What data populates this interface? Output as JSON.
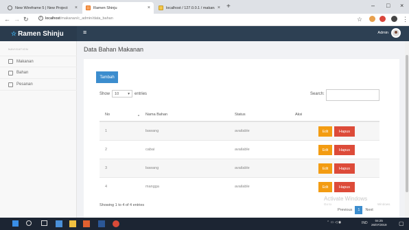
{
  "browser": {
    "tabs": [
      {
        "title": "New Wireframe 5 | New Project",
        "close": "×"
      },
      {
        "title": "Ramen Shinju",
        "close": "×"
      },
      {
        "title": "localhost / 127.0.0.1 / makanan",
        "close": "×"
      }
    ],
    "new_tab": "+",
    "window_controls": [
      "–",
      "□",
      "×"
    ],
    "url_host": "localhost",
    "url_path": "/makanan/c_admin/data_bahan"
  },
  "app": {
    "brand_icon": "☆",
    "brand": "Ramen Shinju",
    "menu_icon": "≡",
    "user": "Admin"
  },
  "sidebar": {
    "heading": "NAVIGATION",
    "items": [
      {
        "label": "Makanan"
      },
      {
        "label": "Bahan"
      },
      {
        "label": "Pesanan"
      }
    ]
  },
  "main": {
    "title": "Data Bahan Makanan",
    "add_button": "Tambah",
    "show_label": "Show",
    "entries_value": "10",
    "entries_label": "entries",
    "search_label": "Search:",
    "table": {
      "headers": [
        "No",
        "Nama Bahan",
        "Status",
        "Aksi"
      ],
      "rows": [
        {
          "no": "1",
          "name": "bawang",
          "status": "available"
        },
        {
          "no": "2",
          "name": "cabai",
          "status": "available"
        },
        {
          "no": "3",
          "name": "bawang",
          "status": "available"
        },
        {
          "no": "4",
          "name": "mangga",
          "status": "available"
        }
      ],
      "edit_label": "Edit",
      "delete_label": "Hapus"
    },
    "info": "Showing 1 to 4 of 4 entries",
    "pager": {
      "prev": "Previous",
      "current": "1",
      "next": "Next"
    },
    "watermark": "Activate Windows",
    "watermark_sub": "Go to",
    "watermark_sub2": "Windows."
  },
  "taskbar": {
    "time": "04:25",
    "date": "26/07/2019",
    "lang": "IND"
  },
  "colors": {
    "header": "#2d4053",
    "primary": "#3c8dce",
    "edit": "#f39c12",
    "delete": "#dd4b39"
  }
}
